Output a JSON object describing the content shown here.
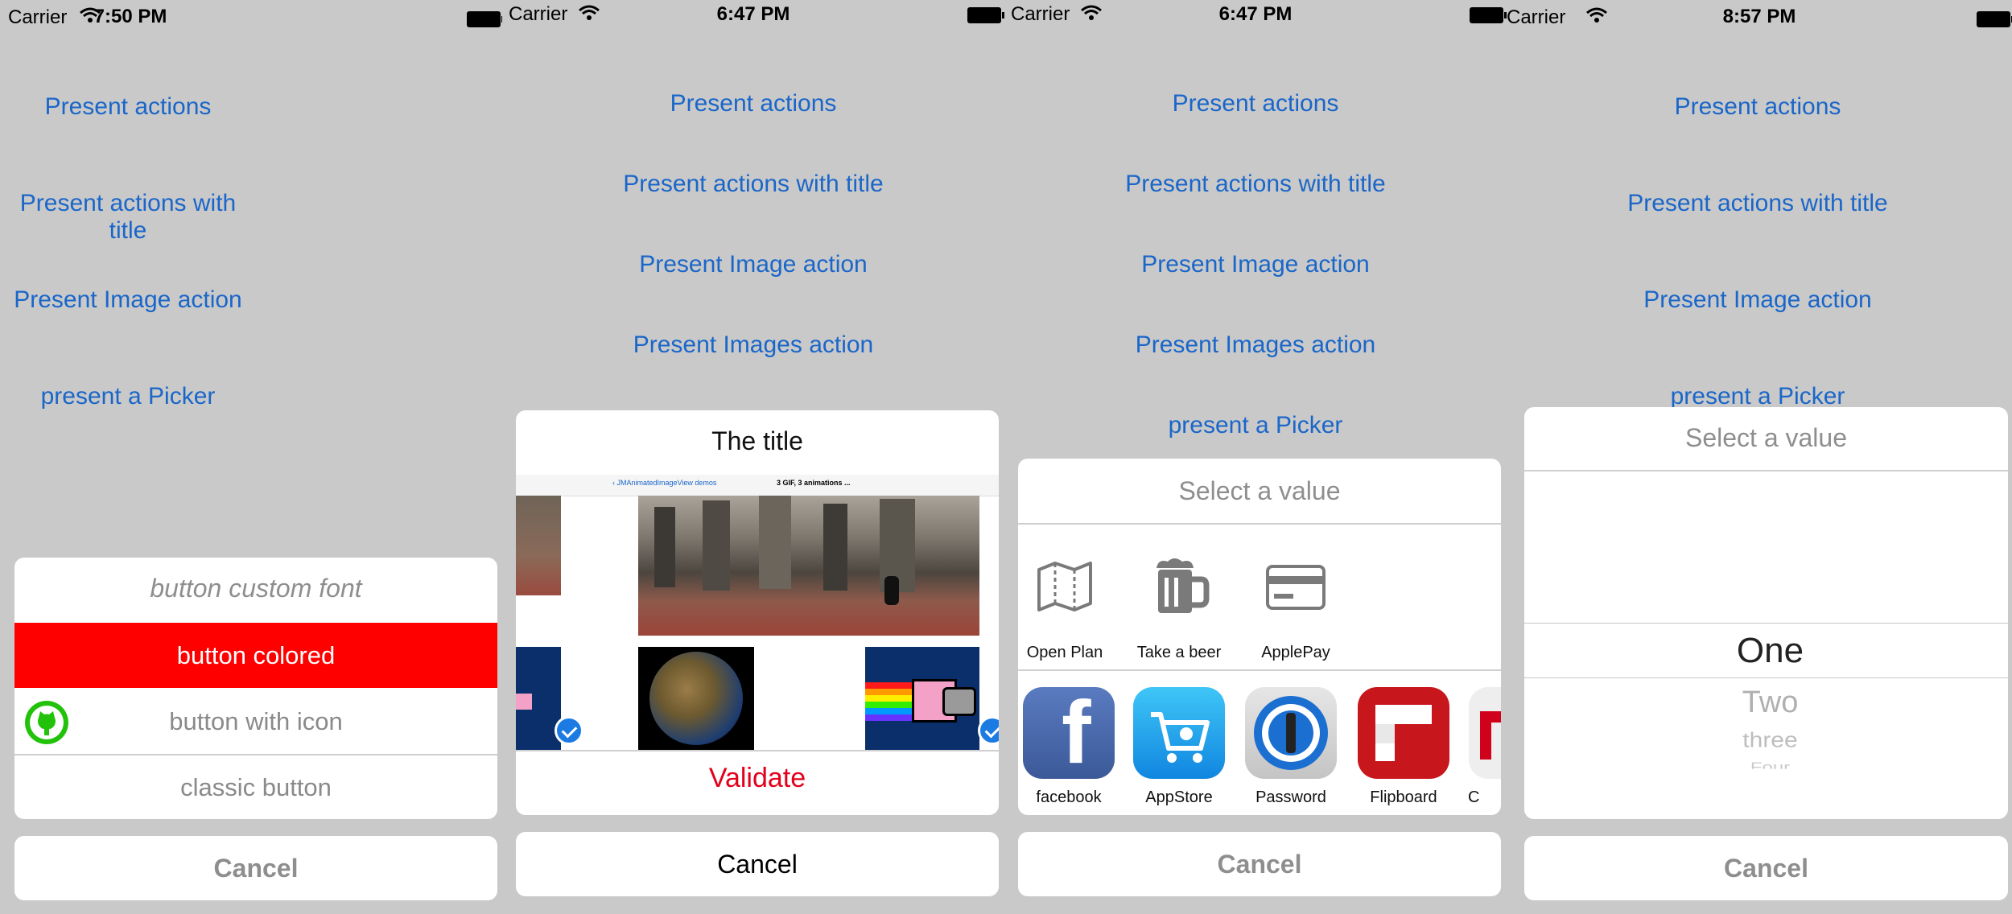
{
  "screens": [
    {
      "status": {
        "carrier": "Carrier",
        "time": "7:50 PM"
      },
      "links": [
        "Present actions",
        "Present actions with title",
        "Present Image action",
        "present a Picker"
      ],
      "sheet": {
        "custom_font_button": "button custom font",
        "colored_button": "button colored",
        "icon_button": "button with icon",
        "classic_button": "classic button"
      },
      "cancel": "Cancel"
    },
    {
      "status": {
        "carrier": "Carrier",
        "time": "6:47 PM"
      },
      "links": [
        "Present actions",
        "Present actions with title",
        "Present Image action",
        "Present Images action"
      ],
      "sheet": {
        "title": "The title",
        "nav_back": "JMAnimatedImageView demos",
        "nav_title": "3 GIF, 3 animations ...",
        "validate": "Validate"
      },
      "cancel": "Cancel"
    },
    {
      "status": {
        "carrier": "Carrier",
        "time": "6:47 PM"
      },
      "links": [
        "Present actions",
        "Present actions with title",
        "Present Image action",
        "Present Images action",
        "present a Picker"
      ],
      "sheet": {
        "title": "Select a value",
        "actions": [
          {
            "label": "Open Plan",
            "icon": "map-icon"
          },
          {
            "label": "Take a beer",
            "icon": "beer-icon"
          },
          {
            "label": "ApplePay",
            "icon": "credit-card-icon"
          }
        ],
        "apps": [
          {
            "label": "facebook",
            "icon": "facebook-icon",
            "color": "#3b5998"
          },
          {
            "label": "AppStore",
            "icon": "appstore-icon",
            "color": "#1aa3ee"
          },
          {
            "label": "Password",
            "icon": "password-icon",
            "color": "#1b6fd1"
          },
          {
            "label": "Flipboard",
            "icon": "flipboard-icon",
            "color": "#c8161d"
          },
          {
            "label": "C",
            "icon": "partial-app-icon",
            "color": "#d0021b"
          }
        ]
      },
      "cancel": "Cancel"
    },
    {
      "status": {
        "carrier": "Carrier",
        "time": "8:57 PM"
      },
      "links": [
        "Present actions",
        "Present actions with title",
        "Present Image action",
        "present a Picker"
      ],
      "sheet": {
        "title": "Select a value",
        "options": [
          "One",
          "Two",
          "three",
          "Four"
        ]
      },
      "cancel": "Cancel"
    }
  ],
  "colors": {
    "link": "#1a66c9",
    "destructive": "#e3001b",
    "colored_button": "#ff0000",
    "github_icon": "#22c20a"
  }
}
